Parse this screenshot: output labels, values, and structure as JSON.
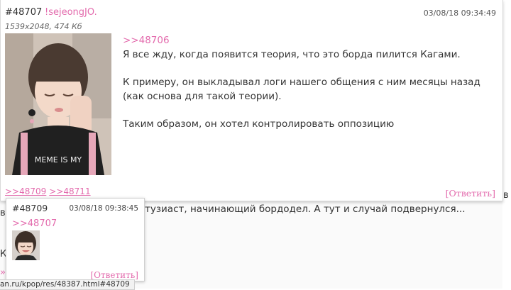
{
  "background_post": {
    "text_line": "тузиаст, начинающий бордодел. А тут и случай подвернулся...",
    "edge_left_top": "во",
    "edge_left_mid": "К",
    "edge_left_bottom": "»",
    "edge_right": "в"
  },
  "main_post": {
    "number": "#48707",
    "name": "!sejeongJO.",
    "date": "03/08/18 09:34:49",
    "image_meta": "1539x2048, 474 Кб",
    "reply_link": ">>48706",
    "line1": "Я все жду, когда появится теория, что это борда пилится Кагами.",
    "paragraph2": "К примеру, он выкладывал логи нашего общения с ним месяцы назад (как основа для такой теории).",
    "paragraph3": "Таким образом, он хотел контролировать оппозицию",
    "replies": [
      ">>48709",
      ">>48711"
    ],
    "answer_label": "[Ответить]"
  },
  "popup_post": {
    "number": "#48709",
    "date": "03/08/18 09:38:45",
    "reply_link": ">>48707",
    "answer_label": "[Ответить]"
  },
  "status_bar": {
    "url": "an.ru/kpop/res/48387.html#48709"
  },
  "colors": {
    "link": "#e36bad",
    "text": "#333333",
    "background": "#ffffff"
  }
}
